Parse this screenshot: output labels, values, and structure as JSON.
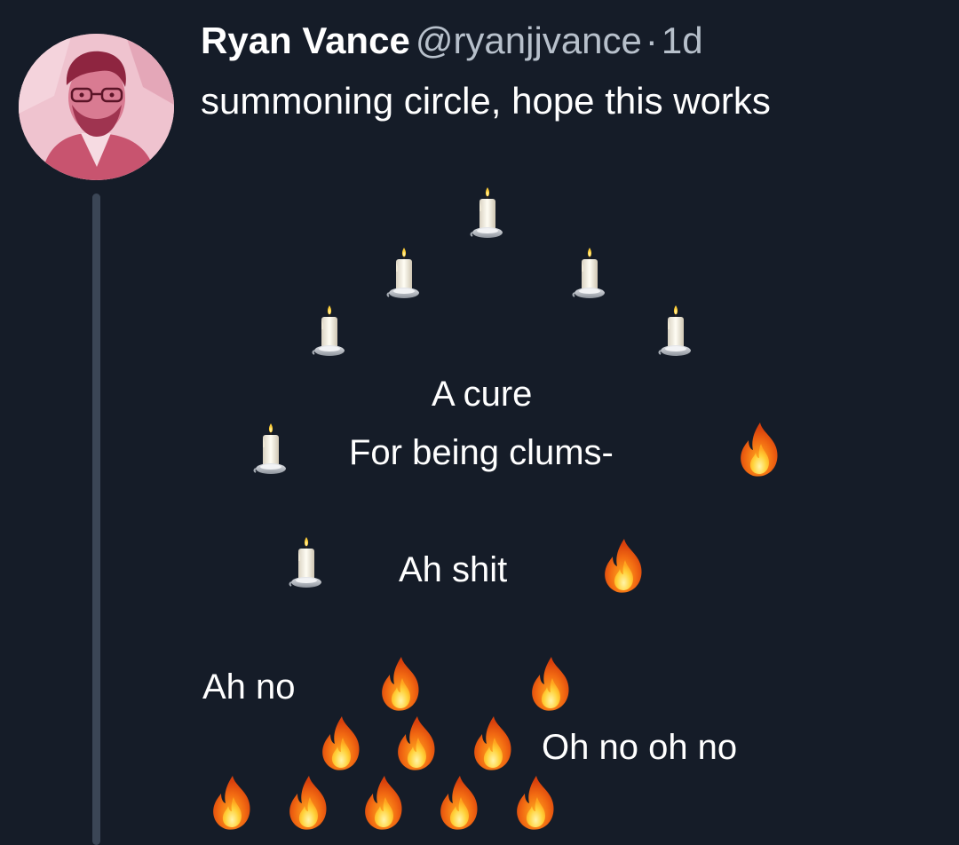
{
  "tweet": {
    "display_name": "Ryan Vance",
    "handle": "@ryanjjvance",
    "separator": "·",
    "time": "1d",
    "text": "summoning circle, hope this works"
  },
  "poem": {
    "line1": "A cure",
    "line2": "For being clums-",
    "line3": "Ah shit",
    "line4": "Ah no",
    "line5": "Oh no oh no"
  },
  "icons": {
    "avatar": "user-avatar-photo",
    "candle": "candle-emoji",
    "fire": "fire-emoji"
  },
  "colors": {
    "background": "#151c28",
    "text": "#ffffff",
    "secondary_text": "#b7c0cb",
    "thread_line": "#3b4656",
    "avatar_tint": "#e9b7c5"
  }
}
